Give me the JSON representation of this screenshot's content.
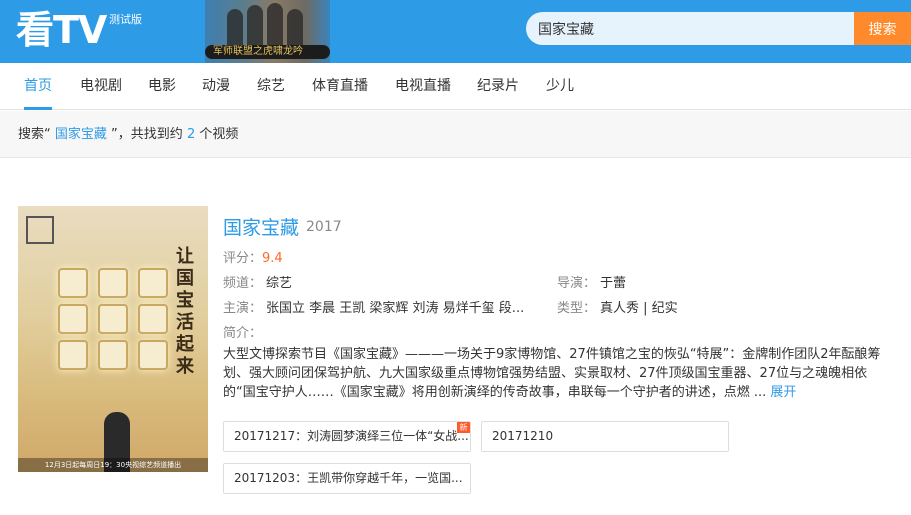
{
  "header": {
    "logo": "看TV",
    "beta": "测试版",
    "banner_text": "军师联盟之虎啸龙吟",
    "search_value": "国家宝藏",
    "search_button": "搜索"
  },
  "nav": {
    "items": [
      "首页",
      "电视剧",
      "电影",
      "动漫",
      "综艺",
      "体育直播",
      "电视直播",
      "纪录片",
      "少儿"
    ],
    "active_index": 0
  },
  "summary": {
    "prefix": "搜索“",
    "query": "国家宝藏",
    "middle": "”，共找到约",
    "count": "2",
    "suffix": "个视频"
  },
  "result": {
    "poster": {
      "vertical_text": "让国宝活起来",
      "caption": "12月3日起每周日19：30央视综艺频道播出"
    },
    "title": "国家宝藏",
    "year": "2017",
    "score_label": "评分：",
    "score": "9.4",
    "channel_label": "频道：",
    "channel": "综艺",
    "director_label": "导演：",
    "director": "于蕾",
    "cast_label": "主演：",
    "cast": "张国立 李晨 王凯 梁家辉 刘涛 易烊千玺 段...",
    "genre_label": "类型：",
    "genre": "真人秀 | 纪实",
    "intro_label": "简介：",
    "description": "大型文博探索节目《国家宝藏》———一场关于9家博物馆、27件镇馆之宝的恢弘“特展”：金牌制作团队2年酝酿筹划、强大顾问团保驾护航、九大国家级重点博物馆强势结盟、实景取材、27件顶级国宝重器、27位与之魂魄相依的“国宝守护人……《国家宝藏》将用创新演绎的传奇故事，串联每一个守护者的讲述，点燃 ...",
    "expand": "展开",
    "episodes": [
      {
        "label": "20171217：刘涛圆梦演绎三位一体“女战...",
        "new": "新"
      },
      {
        "label": "20171210",
        "new": ""
      },
      {
        "label": "20171203：王凯带你穿越千年，一览国...",
        "new": ""
      }
    ]
  },
  "colors": {
    "brand": "#2e9be6",
    "search_button": "#ff8a2b",
    "score": "#ff6a2b"
  }
}
